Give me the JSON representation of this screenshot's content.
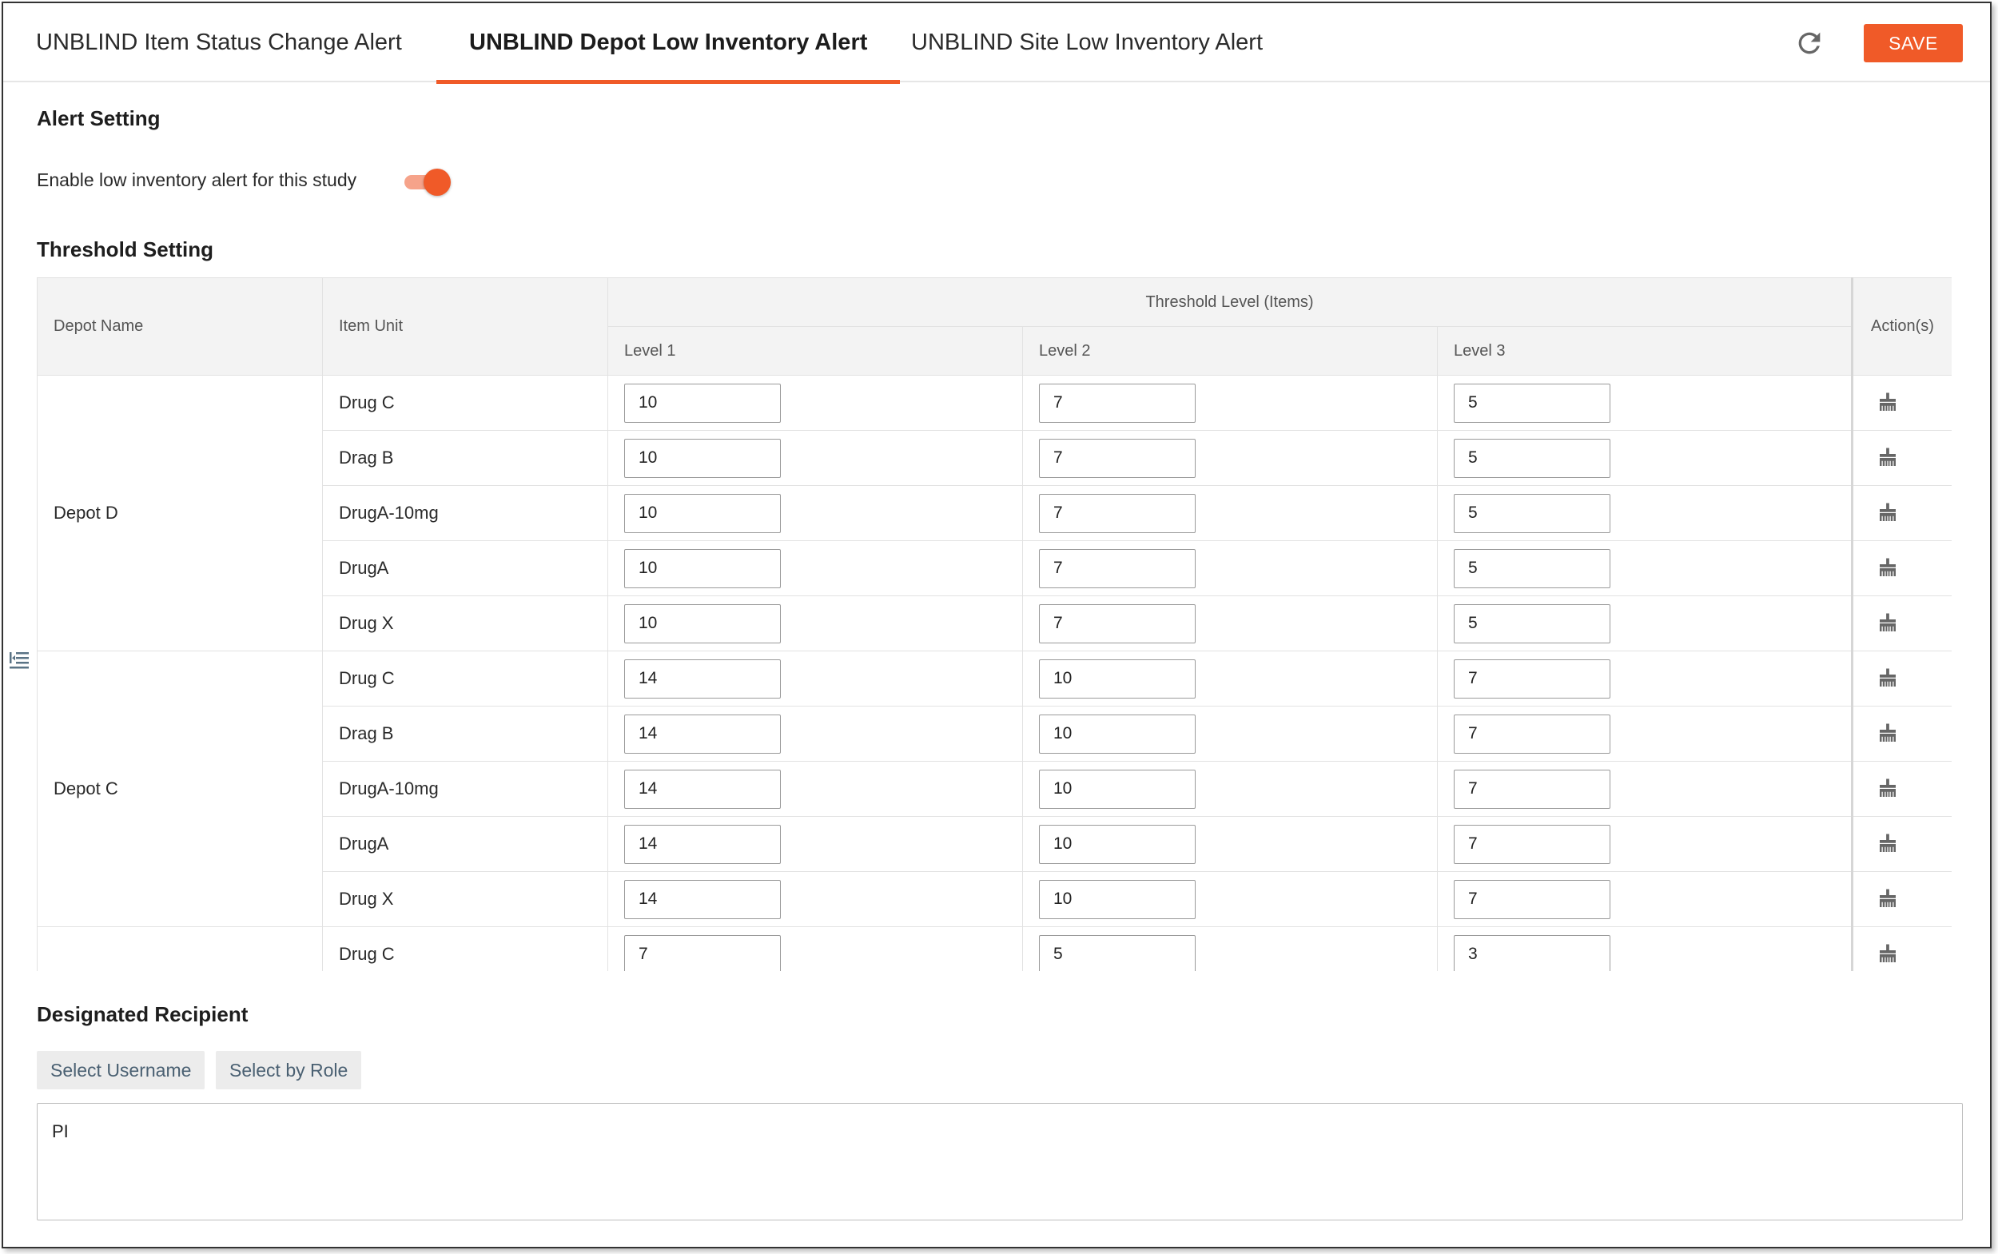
{
  "tabs": [
    {
      "label": "UNBLIND Item Status Change Alert",
      "active": false
    },
    {
      "label": "UNBLIND Depot Low Inventory Alert",
      "active": true
    },
    {
      "label": "UNBLIND Site Low Inventory Alert",
      "active": false
    }
  ],
  "toolbar": {
    "refresh_icon": "refresh-icon",
    "save_label": "SAVE",
    "accent_color": "#f05a28"
  },
  "alert_setting": {
    "title": "Alert Setting",
    "toggle_label": "Enable low inventory alert for this study",
    "enabled": true
  },
  "threshold_setting": {
    "title": "Threshold Setting",
    "headers": {
      "depot": "Depot Name",
      "unit": "Item Unit",
      "group": "Threshold Level (Items)",
      "level1": "Level 1",
      "level2": "Level 2",
      "level3": "Level 3",
      "actions": "Action(s)"
    },
    "depots": [
      {
        "name": "Depot D",
        "rows": [
          {
            "unit": "Drug C",
            "l1": "10",
            "l2": "7",
            "l3": "5"
          },
          {
            "unit": "Drag B",
            "l1": "10",
            "l2": "7",
            "l3": "5"
          },
          {
            "unit": "DrugA-10mg",
            "l1": "10",
            "l2": "7",
            "l3": "5"
          },
          {
            "unit": "DrugA",
            "l1": "10",
            "l2": "7",
            "l3": "5"
          },
          {
            "unit": "Drug X",
            "l1": "10",
            "l2": "7",
            "l3": "5"
          }
        ]
      },
      {
        "name": "Depot C",
        "rows": [
          {
            "unit": "Drug C",
            "l1": "14",
            "l2": "10",
            "l3": "7"
          },
          {
            "unit": "Drag B",
            "l1": "14",
            "l2": "10",
            "l3": "7"
          },
          {
            "unit": "DrugA-10mg",
            "l1": "14",
            "l2": "10",
            "l3": "7"
          },
          {
            "unit": "DrugA",
            "l1": "14",
            "l2": "10",
            "l3": "7"
          },
          {
            "unit": "Drug X",
            "l1": "14",
            "l2": "10",
            "l3": "7"
          }
        ]
      },
      {
        "name": "",
        "rows": [
          {
            "unit": "Drug C",
            "l1": "7",
            "l2": "5",
            "l3": "3"
          }
        ]
      }
    ],
    "action_icon": "broom-icon"
  },
  "recipient": {
    "title": "Designated Recipient",
    "select_username": "Select Username",
    "select_role": "Select by Role",
    "value": "PI"
  }
}
